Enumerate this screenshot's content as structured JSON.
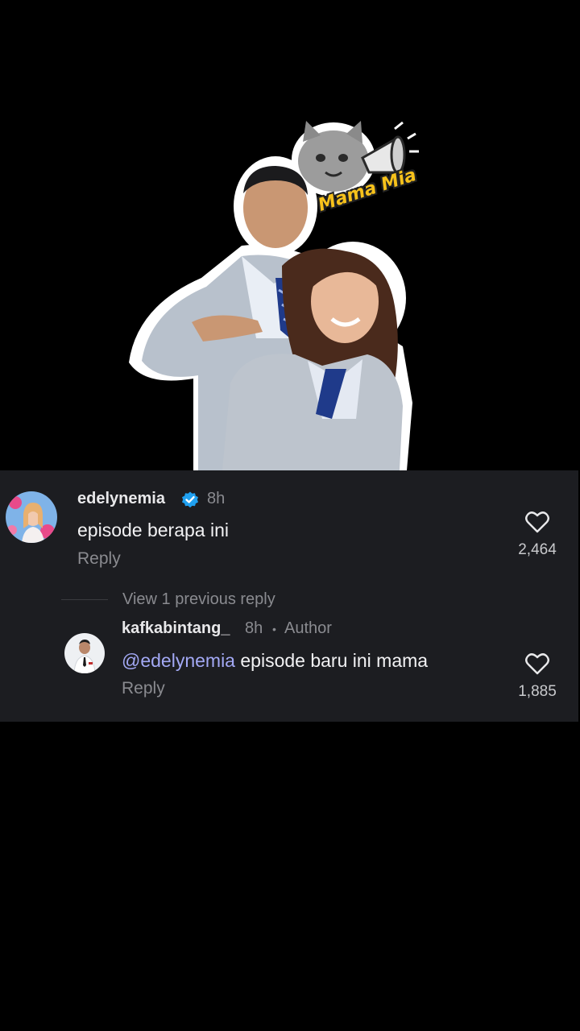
{
  "sticker": {
    "caption": "Mama Mia"
  },
  "comments": [
    {
      "username": "edelynemia",
      "verified": true,
      "time": "8h",
      "text": "episode berapa ini",
      "reply_label": "Reply",
      "likes": "2,464",
      "like_icon": "heart-outline-icon"
    }
  ],
  "view_previous": "View 1 previous reply",
  "reply": {
    "username": "kafkabintang_",
    "time": "8h",
    "separator": "•",
    "role": "Author",
    "mention": "@edelynemia",
    "text": " episode baru ini mama",
    "reply_label": "Reply",
    "likes": "1,885",
    "like_icon": "heart-outline-icon"
  },
  "colors": {
    "background": "#000000",
    "panel": "#1c1d21",
    "mention": "#a3a9f5",
    "verified": "#20a0f0",
    "muted": "#8a8b90"
  }
}
